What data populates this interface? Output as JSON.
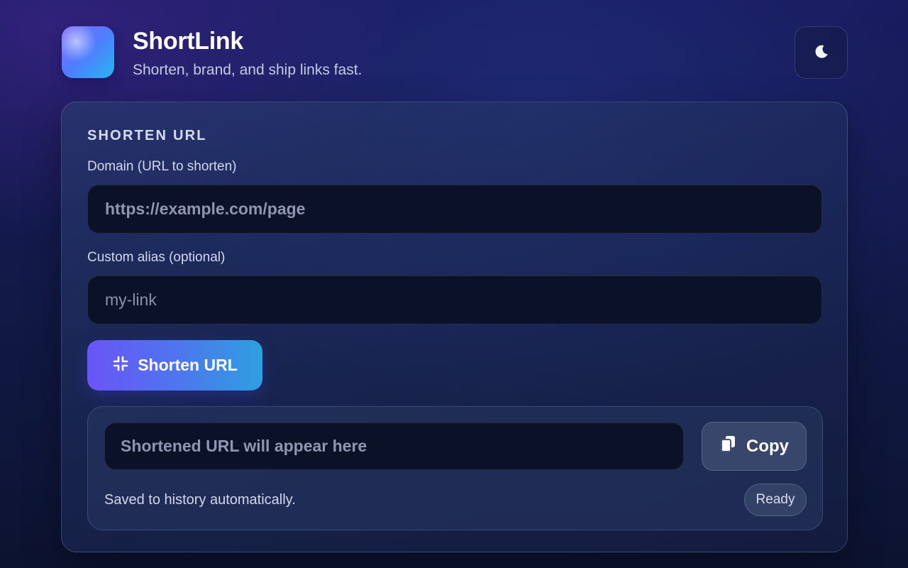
{
  "header": {
    "title": "ShortLink",
    "subtitle": "Shorten, brand, and ship links fast.",
    "theme_toggle_icon": "moon-icon"
  },
  "form": {
    "section_heading": "SHORTEN URL",
    "domain_label": "Domain (URL to shorten)",
    "domain_placeholder": "https://example.com/page",
    "domain_value": "",
    "alias_label": "Custom alias (optional)",
    "alias_placeholder": "my-link",
    "alias_value": "",
    "shorten_button_label": "Shorten URL",
    "shorten_button_icon": "compress-icon"
  },
  "result": {
    "output_placeholder": "Shortened URL will appear here",
    "output_value": "",
    "copy_button_label": "Copy",
    "copy_button_icon": "copy-icon",
    "saved_note": "Saved to history automatically.",
    "status": "Ready"
  },
  "colors": {
    "accent_start": "#6a55f6",
    "accent_end": "#2f9fe0",
    "input_bg": "#0b1126"
  }
}
